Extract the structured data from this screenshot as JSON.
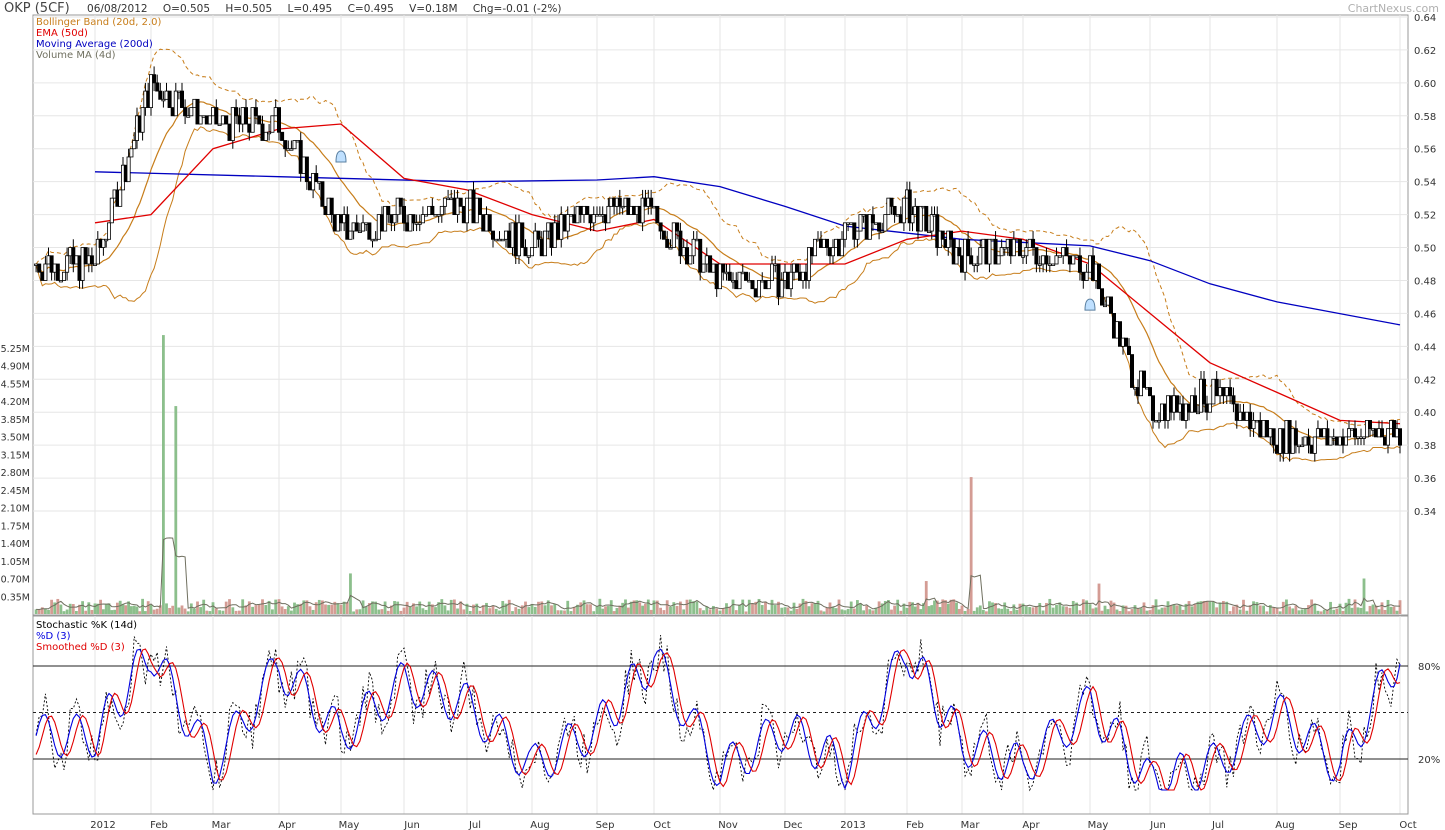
{
  "header": {
    "symbol": "OKP (5CF)",
    "date": "06/08/2012",
    "open": "O=0.505",
    "high": "H=0.505",
    "low": "L=0.495",
    "close": "C=0.495",
    "volume": "V=0.18M",
    "change": "Chg=-0.01 (-2%)"
  },
  "brand": "ChartNexus.com",
  "legend_price": [
    {
      "label": "Bollinger Band (20d, 2.0)",
      "color": "#c77d1a"
    },
    {
      "label": "EMA (50d)",
      "color": "#e00000"
    },
    {
      "label": "Moving Average (200d)",
      "color": "#0000c0"
    },
    {
      "label": "Volume MA (4d)",
      "color": "#707060"
    }
  ],
  "legend_stoch": [
    {
      "label": "Stochastic %K (14d)",
      "color": "#000000"
    },
    {
      "label": "%D (3)",
      "color": "#0000e0"
    },
    {
      "label": "Smoothed %D (3)",
      "color": "#e00000"
    }
  ],
  "colors": {
    "candle": "#000000",
    "volume_up": "#8cbf8c",
    "volume_down": "#d49c94",
    "grid": "#e6e6e6",
    "bollinger": "#c77d1a",
    "ema": "#e00000",
    "ma200": "#0000c0",
    "stoch_k": "#000000",
    "stoch_d": "#0000e0",
    "stoch_smoothed": "#e00000"
  },
  "chart_data": [
    {
      "type": "candlestick",
      "title": "OKP (5CF)",
      "ylim": [
        0.33,
        0.64
      ],
      "y_ticks": [
        "0.64",
        "0.62",
        "0.60",
        "0.58",
        "0.56",
        "0.54",
        "0.52",
        "0.50",
        "0.48",
        "0.46",
        "0.44",
        "0.42",
        "0.40",
        "0.38",
        "0.36",
        "0.34"
      ],
      "x_labels": [
        "2012",
        "Feb",
        "Mar",
        "Apr",
        "May",
        "Jun",
        "Jul",
        "Aug",
        "Sep",
        "Oct",
        "Nov",
        "Dec",
        "2013",
        "Feb",
        "Mar",
        "Apr",
        "May",
        "Jun",
        "Jul",
        "Aug",
        "Sep",
        "Oct"
      ],
      "price_close_by_month": [
        {
          "month": "Jan 2012",
          "close": 0.49
        },
        {
          "month": "Feb 2012",
          "close": 0.6
        },
        {
          "month": "Mar 2012",
          "close": 0.575
        },
        {
          "month": "Apr 2012",
          "close": 0.575
        },
        {
          "month": "May 2012",
          "close": 0.51
        },
        {
          "month": "Jun 2012",
          "close": 0.52
        },
        {
          "month": "Jul 2012",
          "close": 0.525
        },
        {
          "month": "Aug 2012",
          "close": 0.5
        },
        {
          "month": "Sep 2012",
          "close": 0.525
        },
        {
          "month": "Oct 2012",
          "close": 0.52
        },
        {
          "month": "Nov 2012",
          "close": 0.48
        },
        {
          "month": "Dec 2012",
          "close": 0.48
        },
        {
          "month": "Jan 2013",
          "close": 0.51
        },
        {
          "month": "Feb 2013",
          "close": 0.525
        },
        {
          "month": "Mar 2013",
          "close": 0.495
        },
        {
          "month": "Apr 2013",
          "close": 0.5
        },
        {
          "month": "May 2013",
          "close": 0.49
        },
        {
          "month": "Jun 2013",
          "close": 0.4
        },
        {
          "month": "Jul 2013",
          "close": 0.41
        },
        {
          "month": "Aug 2013",
          "close": 0.385
        },
        {
          "month": "Sep 2013",
          "close": 0.385
        },
        {
          "month": "Oct 2013",
          "close": 0.39
        }
      ],
      "series": [
        {
          "name": "Moving Average (200d)",
          "points": [
            [
              "Jan 2012",
              0.546
            ],
            [
              "Apr 2012",
              0.543
            ],
            [
              "Jul 2012",
              0.54
            ],
            [
              "Sep 2012",
              0.541
            ],
            [
              "Oct 2012",
              0.543
            ],
            [
              "Nov 2012",
              0.537
            ],
            [
              "Dec 2012",
              0.525
            ],
            [
              "Jan 2013",
              0.513
            ],
            [
              "Mar 2013",
              0.505
            ],
            [
              "May 2013",
              0.501
            ],
            [
              "Jun 2013",
              0.492
            ],
            [
              "Jul 2013",
              0.478
            ],
            [
              "Aug 2013",
              0.467
            ],
            [
              "Oct 2013",
              0.453
            ]
          ]
        },
        {
          "name": "EMA (50d)",
          "points": [
            [
              "Jan 2012",
              0.515
            ],
            [
              "Feb 2012",
              0.52
            ],
            [
              "Mar 2012",
              0.56
            ],
            [
              "Apr 2012",
              0.572
            ],
            [
              "May 2012",
              0.575
            ],
            [
              "Jun 2012",
              0.542
            ],
            [
              "Jul 2012",
              0.535
            ],
            [
              "Aug 2012",
              0.52
            ],
            [
              "Sep 2012",
              0.51
            ],
            [
              "Oct 2012",
              0.517
            ],
            [
              "Nov 2012",
              0.49
            ],
            [
              "Dec 2012",
              0.49
            ],
            [
              "Jan 2013",
              0.49
            ],
            [
              "Feb 2013",
              0.505
            ],
            [
              "Mar 2013",
              0.51
            ],
            [
              "Apr 2013",
              0.505
            ],
            [
              "May 2013",
              0.49
            ],
            [
              "Jun 2013",
              0.46
            ],
            [
              "Jul 2013",
              0.43
            ],
            [
              "Aug 2013",
              0.412
            ],
            [
              "Sep 2013",
              0.395
            ],
            [
              "Oct 2013",
              0.393
            ]
          ]
        }
      ],
      "markers": [
        [
          "May 2012",
          0.555
        ],
        [
          "May 2013",
          0.465
        ]
      ]
    },
    {
      "type": "bar",
      "title": "Volume",
      "ylim": [
        0,
        5.6
      ],
      "y_ticks": [
        "5.25M",
        "4.90M",
        "4.55M",
        "4.20M",
        "3.85M",
        "3.50M",
        "3.15M",
        "2.80M",
        "2.45M",
        "2.10M",
        "1.75M",
        "1.40M",
        "1.05M",
        "0.70M",
        "0.35M"
      ],
      "peaks_millions": [
        {
          "date": "Feb 2012",
          "value": 5.5
        },
        {
          "date": "Feb 2012",
          "value": 4.1
        },
        {
          "date": "May 2012",
          "value": 0.8
        },
        {
          "date": "Mar 2013",
          "value": 2.7
        },
        {
          "date": "Feb 2013",
          "value": 0.65
        },
        {
          "date": "May 2013",
          "value": 0.6
        },
        {
          "date": "Sep 2013",
          "value": 0.7
        }
      ]
    },
    {
      "type": "line",
      "title": "Stochastic %K (14d)",
      "ylim": [
        0,
        100
      ],
      "y_ticks": [
        "80%",
        "20%"
      ],
      "reference_lines": [
        20,
        50,
        80
      ],
      "series": [
        {
          "name": "%D (3)",
          "monthly_values": [
            [
              "Jan 2012",
              35
            ],
            [
              "Feb 2012",
              90
            ],
            [
              "Mar 2012",
              15
            ],
            [
              "Apr 2012",
              80
            ],
            [
              "May 2012",
              35
            ],
            [
              "Jun 2012",
              70
            ],
            [
              "Jul 2012",
              55
            ],
            [
              "Aug 2012",
              15
            ],
            [
              "Sep 2012",
              40
            ],
            [
              "Oct 2012",
              85
            ],
            [
              "Nov 2012",
              12
            ],
            [
              "Dec 2012",
              40
            ],
            [
              "Jan 2013",
              15
            ],
            [
              "Feb 2013",
              90
            ],
            [
              "Mar 2013",
              30
            ],
            [
              "Apr 2013",
              15
            ],
            [
              "May 2013",
              55
            ],
            [
              "Jun 2013",
              5
            ],
            [
              "Jul 2013",
              15
            ],
            [
              "Aug 2013",
              50
            ],
            [
              "Sep 2013",
              15
            ],
            [
              "Oct 2013",
              88
            ]
          ]
        }
      ]
    }
  ]
}
